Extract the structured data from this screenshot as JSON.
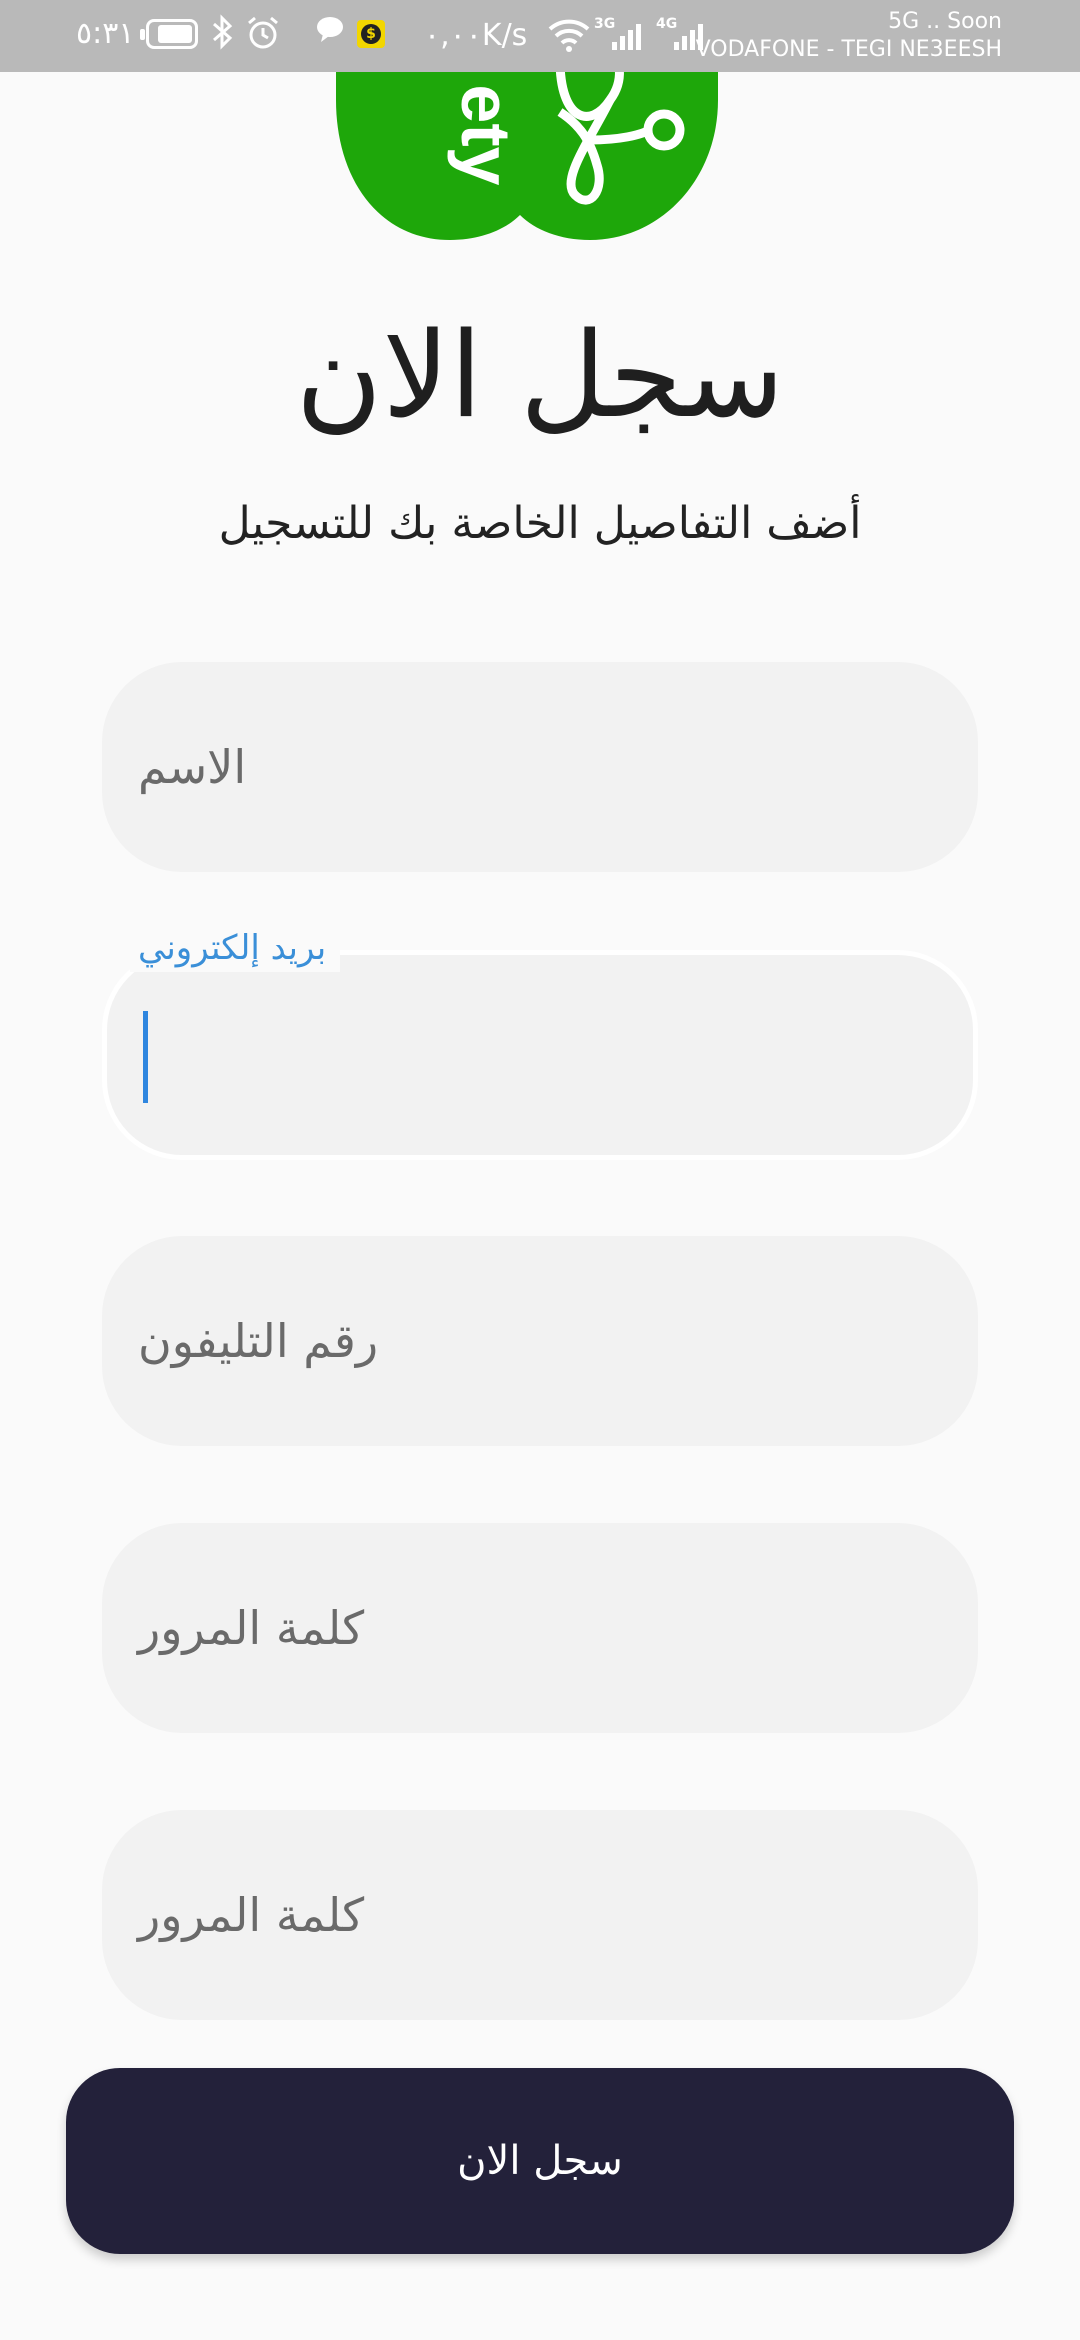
{
  "status_bar": {
    "time": "٥:٣١",
    "network_speed": "٠,٠٠K/s",
    "network_type_1": "3G",
    "network_type_2": "4G",
    "carrier_line_1": "5G .. Soon",
    "carrier_line_2": "VODAFONE - TEGI NE3EESH",
    "battery_level": 0.85,
    "icons": [
      "battery-icon",
      "bluetooth-icon",
      "alarm-icon",
      "chat-icon",
      "dollar-app-icon",
      "wifi-icon",
      "signal-icon"
    ]
  },
  "logo": {
    "text": "ety",
    "icon": "stethoscope-icon",
    "color": "#1ea70a"
  },
  "header": {
    "title": "سجل الان",
    "subtitle": "أضف التفاصيل الخاصة بك للتسجيل"
  },
  "form": {
    "name_placeholder": "الاسم",
    "email_label": "بريد إلكتروني",
    "email_value": "",
    "phone_placeholder": "رقم التليفون",
    "password_placeholder": "كلمة المرور",
    "confirm_password_placeholder": "كلمة المرور",
    "submit_label": "سجل الان"
  },
  "colors": {
    "accent_blue": "#3a8fd8",
    "button_dark": "#23213a",
    "field_bg": "#f2f2f2",
    "status_bar_bg": "#b9b9b9"
  }
}
